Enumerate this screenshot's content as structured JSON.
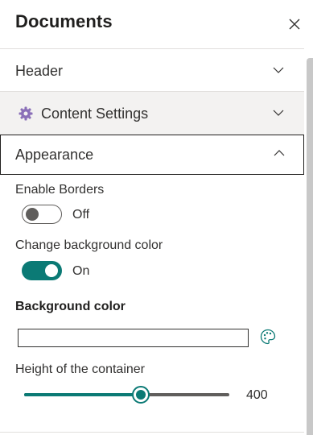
{
  "panel": {
    "title": "Documents",
    "close_icon": "close-icon"
  },
  "sections": {
    "header": {
      "label": "Header",
      "expanded": false
    },
    "content_settings": {
      "label": "Content Settings",
      "icon": "gear-icon",
      "expanded": false
    },
    "appearance": {
      "label": "Appearance",
      "expanded": true
    }
  },
  "appearance": {
    "enable_borders": {
      "label": "Enable Borders",
      "state_text": "Off",
      "checked": false
    },
    "change_bg": {
      "label": "Change background color",
      "state_text": "On",
      "checked": true
    },
    "background_color": {
      "label": "Background color",
      "value": "",
      "palette_icon": "palette-icon"
    },
    "height": {
      "label": "Height of the container",
      "value": "400",
      "min": 0,
      "max": 700,
      "fill_fraction": 0.57
    }
  },
  "colors": {
    "accent": "#0b7a75",
    "text": "#323130",
    "section_bg": "#f3f2f1",
    "gear": "#8a6fb8"
  }
}
